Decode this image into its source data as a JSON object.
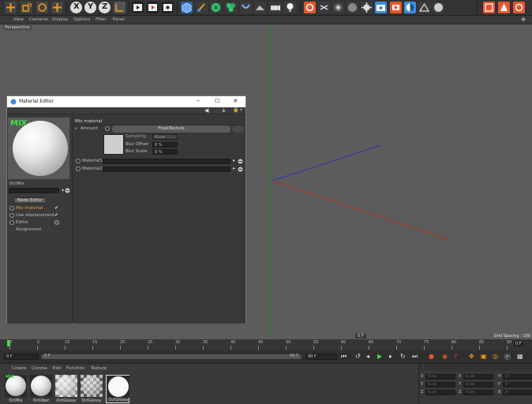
{
  "toolbar": {
    "axis_x": "X",
    "axis_y": "Y",
    "axis_z": "Z",
    "icons": [
      "move-icon",
      "scale-icon",
      "rotate-icon",
      "add-icon",
      "x-axis-icon",
      "y-axis-icon",
      "z-axis-icon",
      "coord-system-icon",
      "render-view-icon",
      "render-picture-viewer-icon",
      "render-settings-icon",
      "cube-icon",
      "pen-icon",
      "subdivision-icon",
      "cloner-icon",
      "deformer-icon",
      "scene-icon",
      "camera-icon",
      "light-icon",
      "octane-icon",
      "octane-live-icon",
      "octane-settings-icon",
      "octane-material-icon",
      "octane-object-icon",
      "octane-camera-icon",
      "octane-light-icon",
      "octane-tonemap-icon",
      "octane-sky-icon",
      "layout-icon"
    ]
  },
  "viewport": {
    "menu": [
      "View",
      "Cameras",
      "Display",
      "Options",
      "Filter",
      "Panel"
    ],
    "label": "Perspective",
    "grid_spacing": "Grid Spacing : 100"
  },
  "material_editor": {
    "title": "Material Editor",
    "material_name": "OctMix",
    "node_editor_label": "Node Editor",
    "left_items": [
      {
        "label": "Mix material",
        "checked": true,
        "active": true
      },
      {
        "label": "Use displacement",
        "checked": true,
        "active": false
      },
      {
        "label": "Editor",
        "checked": false,
        "active": false
      },
      {
        "label": "Assignment",
        "checked": false,
        "active": false
      }
    ],
    "section_title": "Mix material",
    "amount_label": "Amount",
    "texture_button": "FloatTexture",
    "sampling_label": "Sampling",
    "sampling_value": "None",
    "blur_offset_label": "Blur Offset",
    "blur_offset_value": "0 %",
    "blur_scale_label": "Blur Scale",
    "blur_scale_value": "0 %",
    "material1_label": "Material1",
    "material2_label": "Material2",
    "preview_badge": "MIX"
  },
  "timeline": {
    "ticks": [
      "0",
      "5",
      "10",
      "15",
      "20",
      "25",
      "30",
      "35",
      "40",
      "45",
      "50",
      "55",
      "60",
      "65",
      "70",
      "75",
      "80",
      "85",
      "90"
    ],
    "end_frame": "0 F",
    "current_frame": "0 F",
    "start_field": "0 F",
    "min_field": "0 F",
    "max_field": "90 F",
    "max_field2": "90 F",
    "viewport_frame": "0 F"
  },
  "material_manager": {
    "menu": [
      "Create",
      "Corona",
      "Edit",
      "Function",
      "Texture"
    ],
    "materials": [
      {
        "name": "OctMix"
      },
      {
        "name": "OctUber"
      },
      {
        "name": "OctGlossy"
      },
      {
        "name": "OctGlossy"
      },
      {
        "name": "OctGlossy"
      }
    ]
  },
  "coordinates": {
    "rows": [
      {
        "a": "X",
        "av": "0 cm",
        "b": "X",
        "bv": "0 cm",
        "c": "H",
        "cv": "0 °"
      },
      {
        "a": "Y",
        "av": "0 cm",
        "b": "Y",
        "bv": "0 cm",
        "c": "P",
        "cv": "0 °"
      },
      {
        "a": "Z",
        "av": "0 cm",
        "b": "Z",
        "bv": "0 cm",
        "c": "B",
        "cv": "0 °"
      }
    ]
  }
}
